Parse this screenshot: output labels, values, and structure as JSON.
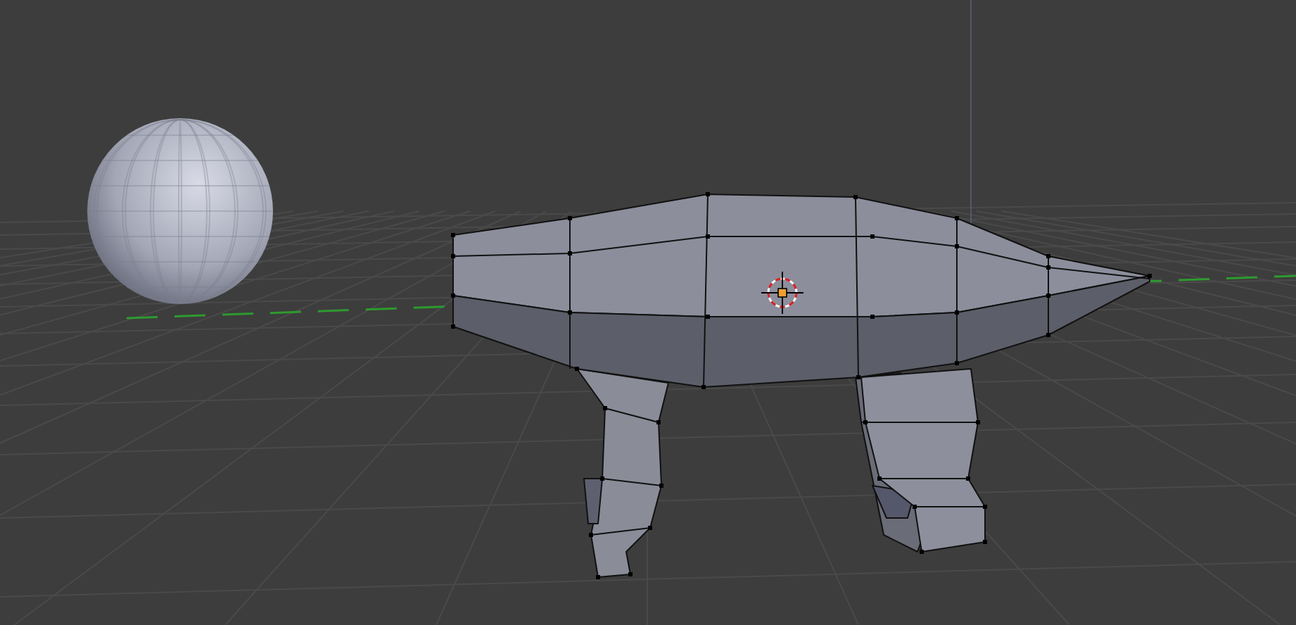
{
  "viewport": {
    "show_grid": true,
    "show_cursor": true,
    "objects": [
      {
        "kind": "sphere",
        "selected": false
      },
      {
        "kind": "creature",
        "selected": true
      }
    ]
  }
}
